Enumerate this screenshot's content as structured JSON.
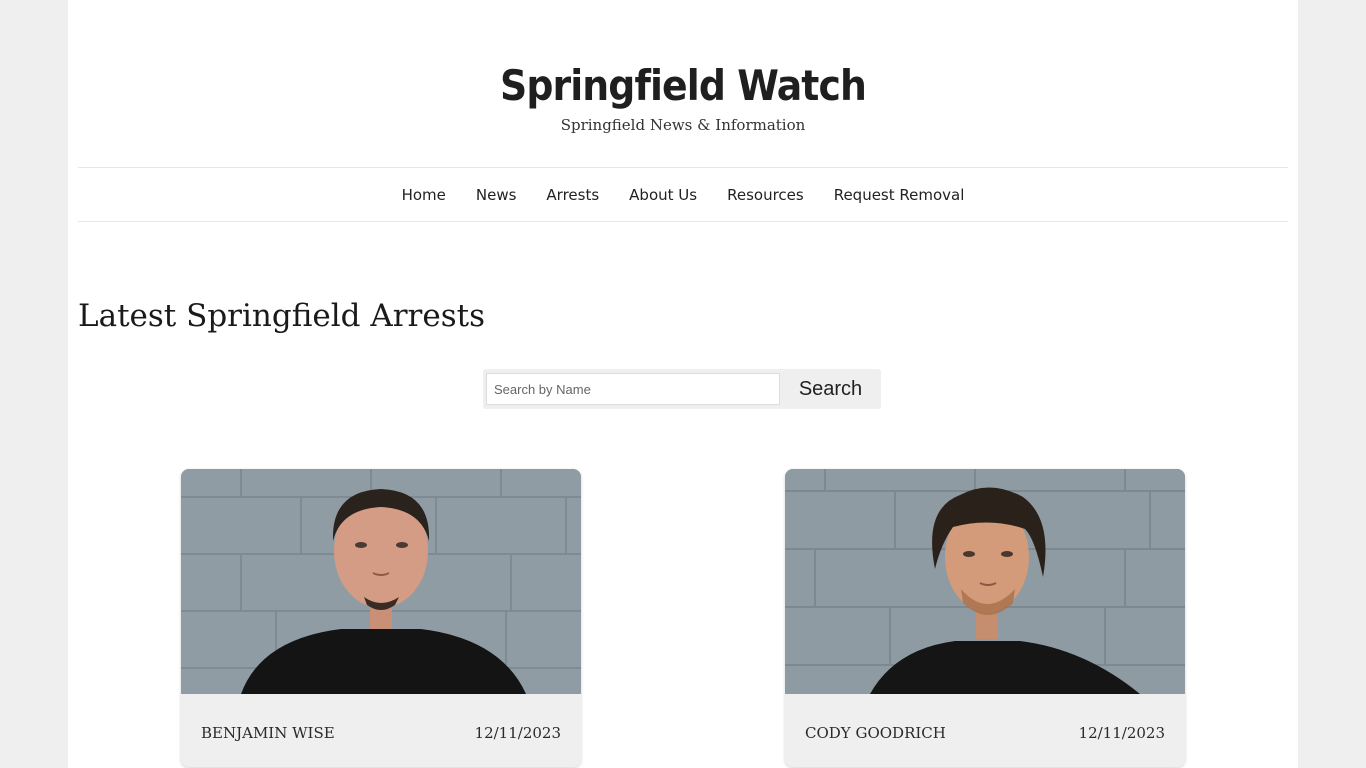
{
  "site": {
    "title": "Springfield Watch",
    "tagline": "Springfield News & Information"
  },
  "nav": {
    "items": [
      "Home",
      "News",
      "Arrests",
      "About Us",
      "Resources",
      "Request Removal"
    ]
  },
  "main": {
    "heading": "Latest Springfield Arrests",
    "search": {
      "placeholder": "Search by Name",
      "value": "",
      "button_label": "Search"
    },
    "arrests": [
      {
        "name": "BENJAMIN WISE",
        "date": "12/11/2023"
      },
      {
        "name": "CODY GOODRICH",
        "date": "12/11/2023"
      }
    ]
  }
}
